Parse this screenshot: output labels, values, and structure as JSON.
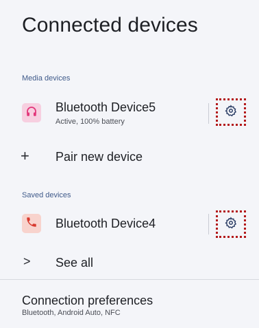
{
  "header": {
    "title": "Connected devices"
  },
  "media_section": {
    "label": "Media devices",
    "device": {
      "name": "Bluetooth Device5",
      "status": "Active, 100% battery",
      "icon": "headphones-icon",
      "icon_color": "#e2367a",
      "tile_color": "#f7cfe0"
    }
  },
  "pair_new": {
    "glyph": "+",
    "label": "Pair new device"
  },
  "saved_section": {
    "label": "Saved devices",
    "device": {
      "name": "Bluetooth Device4",
      "icon": "phone-icon",
      "icon_color": "#d83a2f",
      "tile_color": "#f8d3cd"
    }
  },
  "see_all": {
    "glyph": ">",
    "label": "See all"
  },
  "preferences": {
    "title": "Connection preferences",
    "subtitle": "Bluetooth, Android Auto, NFC"
  },
  "colors": {
    "background": "#f4f5f9",
    "section_header": "#3f5a8a",
    "gear": "#2d3f66",
    "highlight_border": "#b3191b"
  }
}
